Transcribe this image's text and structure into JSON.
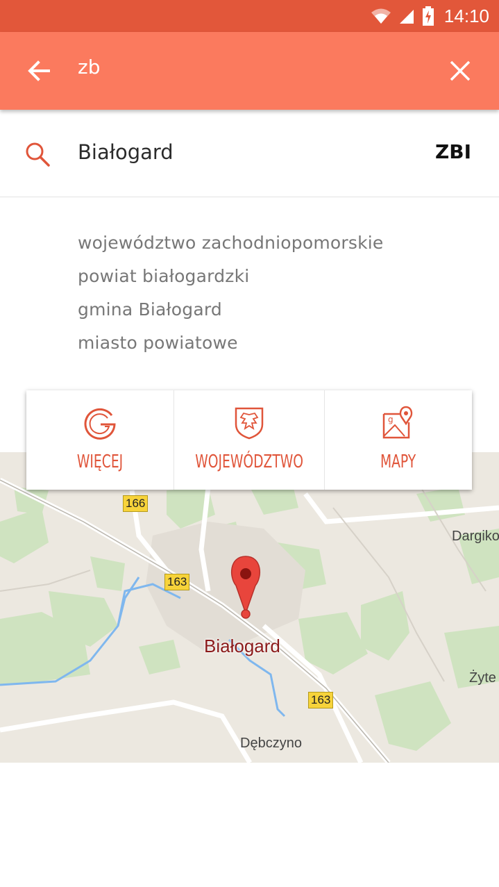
{
  "status_bar": {
    "time": "14:10",
    "icons": [
      "wifi-icon",
      "signal-icon",
      "battery-charging-icon"
    ]
  },
  "app_bar": {
    "back_icon": "arrow-left-icon",
    "query": "zb",
    "clear_icon": "close-icon"
  },
  "result": {
    "icon": "search-icon",
    "name": "Białogard",
    "code": "ZBI"
  },
  "details": [
    "województwo zachodniopomorskie",
    "powiat białogardzki",
    "gmina Białogard",
    "miasto powiatowe"
  ],
  "actions": [
    {
      "icon": "google-g-icon",
      "label": "WIĘCEJ"
    },
    {
      "icon": "coat-of-arms-icon",
      "label": "WOJEWÓDZTWO"
    },
    {
      "icon": "map-pin-icon",
      "label": "MAPY"
    }
  ],
  "map": {
    "city_label": "Białogard",
    "places": [
      "Dargiko",
      "Żyte",
      "Dębczyno"
    ],
    "roads": [
      "166",
      "163",
      "163"
    ]
  },
  "colors": {
    "status_bar": "#e2573a",
    "app_bar": "#fb7a5e",
    "accent": "#e0553a"
  }
}
